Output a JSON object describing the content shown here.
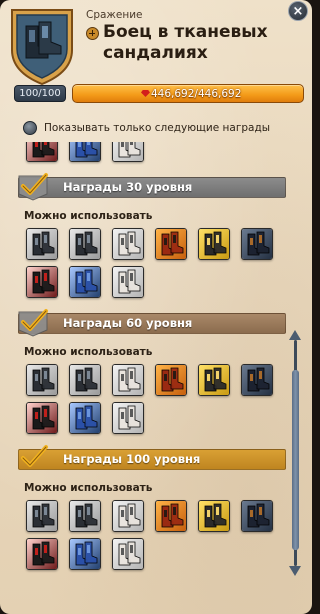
{
  "header": {
    "category": "Сражение",
    "title_line1": "Боец в тканевых",
    "title_line2": "сандалиях",
    "close": "×"
  },
  "progress": {
    "level_text": "100/100",
    "xp_text": "446,692/446,692",
    "level_fraction": 1.0,
    "xp_fraction": 1.0
  },
  "filter": {
    "label": "Показывать только следующие награды",
    "checked": false
  },
  "sections": [
    {
      "title": "",
      "usable_label": "",
      "items": [
        "red",
        "blue",
        "white"
      ]
    },
    {
      "title": "Награды 30 уровня",
      "style": "grey",
      "usable_label": "Можно использовать",
      "items": [
        "grey",
        "grey",
        "white",
        "orange",
        "yellow",
        "navy",
        "red",
        "blue",
        "white"
      ]
    },
    {
      "title": "Награды 60 уровня",
      "style": "brown",
      "usable_label": "Можно использовать",
      "items": [
        "grey",
        "grey",
        "white",
        "orange",
        "yellow",
        "navy",
        "red",
        "blue",
        "white"
      ]
    },
    {
      "title": "Награды 100 уровня",
      "style": "gold",
      "usable_label": "Можно использовать",
      "items": [
        "grey",
        "grey",
        "white",
        "orange",
        "yellow",
        "navy",
        "red",
        "blue",
        "white"
      ]
    }
  ],
  "colors": {
    "accent_orange": "#f39a18",
    "xp_gem": "#d3201c",
    "panel_bg": "#efe1c9",
    "check_gold": "#f1b21e"
  },
  "icons": {
    "item_icon": "sandal-boots-icon",
    "section_check_icon": "checkmark-icon",
    "badge_icon": "shield-badge-icon"
  }
}
